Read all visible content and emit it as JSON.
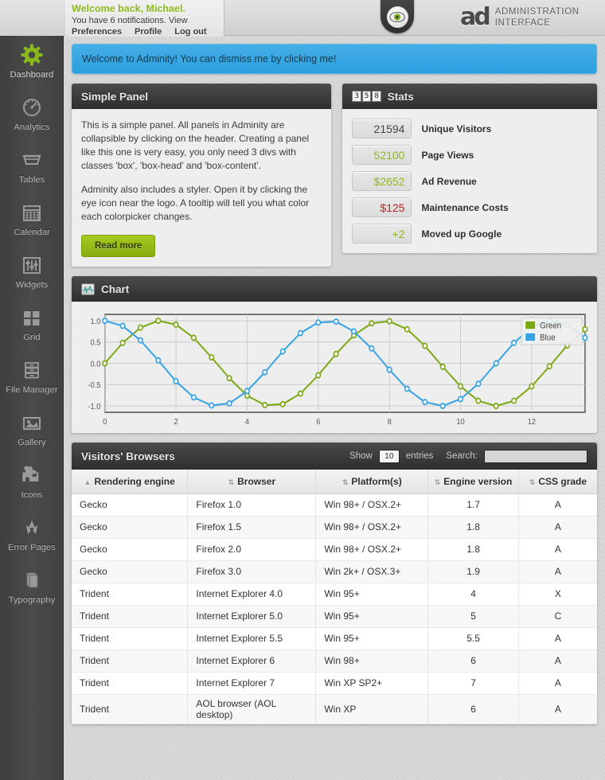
{
  "topbar": {
    "welcome_title": "Welcome back, Michael.",
    "welcome_sub": "You have 6 notifications. View",
    "links": [
      "Preferences",
      "Profile",
      "Log out"
    ],
    "brand_mark": "ad",
    "brand_line1": "ADMINISTRATION",
    "brand_line2": "INTERFACE",
    "eye_icon": "eye-icon"
  },
  "sidebar": {
    "items": [
      {
        "label": "Dashboard",
        "icon": "gear-icon",
        "active": true
      },
      {
        "label": "Analytics",
        "icon": "gauge-icon",
        "active": false
      },
      {
        "label": "Tables",
        "icon": "table-tray-icon",
        "active": false
      },
      {
        "label": "Calendar",
        "icon": "calendar-icon",
        "active": false
      },
      {
        "label": "Widgets",
        "icon": "sliders-icon",
        "active": false
      },
      {
        "label": "Grid",
        "icon": "grid-icon",
        "active": false
      },
      {
        "label": "File Manager",
        "icon": "file-cabinet-icon",
        "active": false
      },
      {
        "label": "Gallery",
        "icon": "image-icon",
        "active": false
      },
      {
        "label": "Icons",
        "icon": "puzzle-icon",
        "active": false
      },
      {
        "label": "Error Pages",
        "icon": "radiation-icon",
        "active": false
      },
      {
        "label": "Typography",
        "icon": "book-icon",
        "active": false
      }
    ]
  },
  "notice": {
    "text": "Welcome to Adminity! You can dismiss me by clicking me!"
  },
  "simple_panel": {
    "title": "Simple Panel",
    "paragraph1": "This is a simple panel. All panels in Adminity are collapsible by clicking on the header. Creating a panel like this one is very easy, you only need 3 divs with classes 'box', 'box-head' and 'box-content'.",
    "paragraph2": "Adminity also includes a styler. Open it by clicking the eye icon near the logo. A tooltip will tell you what color each colorpicker changes.",
    "button_label": "Read more"
  },
  "stats_panel": {
    "title": "Stats",
    "icon": "counter-icon",
    "icon_digits": "358",
    "rows": [
      {
        "value": "21594",
        "label": "Unique Visitors",
        "color": "#454545"
      },
      {
        "value": "52100",
        "label": "Page Views",
        "color": "#8eb81e"
      },
      {
        "value": "$2652",
        "label": "Ad Revenue",
        "color": "#8eb81e"
      },
      {
        "value": "$125",
        "label": "Maintenance Costs",
        "color": "#b02b2b"
      },
      {
        "value": "+2",
        "label": "Moved up Google",
        "color": "#8eb81e"
      }
    ]
  },
  "chart_panel": {
    "title": "Chart",
    "icon": "waveform-monitor-icon"
  },
  "chart_data": {
    "type": "line",
    "title": "Chart",
    "xlabel": "",
    "ylabel": "",
    "xlim": [
      0,
      13.5
    ],
    "ylim": [
      -1.15,
      1.15
    ],
    "xticks": [
      0,
      2,
      4,
      6,
      8,
      10,
      12
    ],
    "yticks": [
      -1.0,
      -0.5,
      0.0,
      0.5,
      1.0
    ],
    "ytick_labels": [
      "-1.0",
      "-0.5",
      "0.0",
      "0.5",
      "1.0"
    ],
    "grid": true,
    "legend_position": "top-right",
    "markers": "open-circle",
    "x": [
      0,
      0.5,
      1.0,
      1.5,
      2.0,
      2.5,
      3.0,
      3.5,
      4.0,
      4.5,
      5.0,
      5.5,
      6.0,
      6.5,
      7.0,
      7.5,
      8.0,
      8.5,
      9.0,
      9.5,
      10.0,
      10.5,
      11.0,
      11.5,
      12.0,
      12.5,
      13.0,
      13.5
    ],
    "series": [
      {
        "name": "Green",
        "color": "#7ba916",
        "values": [
          0.0,
          0.48,
          0.84,
          1.0,
          0.91,
          0.6,
          0.14,
          -0.35,
          -0.76,
          -0.98,
          -0.96,
          -0.71,
          -0.28,
          0.22,
          0.66,
          0.94,
          0.99,
          0.8,
          0.41,
          -0.08,
          -0.54,
          -0.88,
          -1.0,
          -0.88,
          -0.54,
          -0.07,
          0.42,
          0.8
        ]
      },
      {
        "name": "Blue",
        "color": "#36a3e2",
        "values": [
          1.0,
          0.88,
          0.54,
          0.07,
          -0.42,
          -0.8,
          -0.99,
          -0.94,
          -0.65,
          -0.21,
          0.28,
          0.71,
          0.96,
          0.98,
          0.75,
          0.35,
          -0.15,
          -0.6,
          -0.91,
          -1.0,
          -0.84,
          -0.48,
          0.0,
          0.48,
          0.84,
          1.0,
          0.91,
          0.6
        ]
      }
    ]
  },
  "table_panel": {
    "title": "Visitors' Browsers",
    "show_label": "Show",
    "show_value": "10",
    "entries_label": "entries",
    "search_label": "Search:",
    "search_value": "",
    "search_placeholder": "",
    "columns": [
      {
        "label": "Rendering engine",
        "sortable": true,
        "sort": "asc"
      },
      {
        "label": "Browser",
        "sortable": true,
        "sort": "none"
      },
      {
        "label": "Platform(s)",
        "sortable": true,
        "sort": "none"
      },
      {
        "label": "Engine version",
        "sortable": false,
        "sort": "none"
      },
      {
        "label": "CSS grade",
        "sortable": false,
        "sort": "none"
      }
    ],
    "rows": [
      [
        "Gecko",
        "Firefox 1.0",
        "Win 98+ / OSX.2+",
        "1.7",
        "A"
      ],
      [
        "Gecko",
        "Firefox 1.5",
        "Win 98+ / OSX.2+",
        "1.8",
        "A"
      ],
      [
        "Gecko",
        "Firefox 2.0",
        "Win 98+ / OSX.2+",
        "1.8",
        "A"
      ],
      [
        "Gecko",
        "Firefox 3.0",
        "Win 2k+ / OSX.3+",
        "1.9",
        "A"
      ],
      [
        "Trident",
        "Internet Explorer 4.0",
        "Win 95+",
        "4",
        "X"
      ],
      [
        "Trident",
        "Internet Explorer 5.0",
        "Win 95+",
        "5",
        "C"
      ],
      [
        "Trident",
        "Internet Explorer 5.5",
        "Win 95+",
        "5.5",
        "A"
      ],
      [
        "Trident",
        "Internet Explorer 6",
        "Win 98+",
        "6",
        "A"
      ],
      [
        "Trident",
        "Internet Explorer 7",
        "Win XP SP2+",
        "7",
        "A"
      ],
      [
        "Trident",
        "AOL browser (AOL desktop)",
        "Win XP",
        "6",
        "A"
      ]
    ]
  }
}
